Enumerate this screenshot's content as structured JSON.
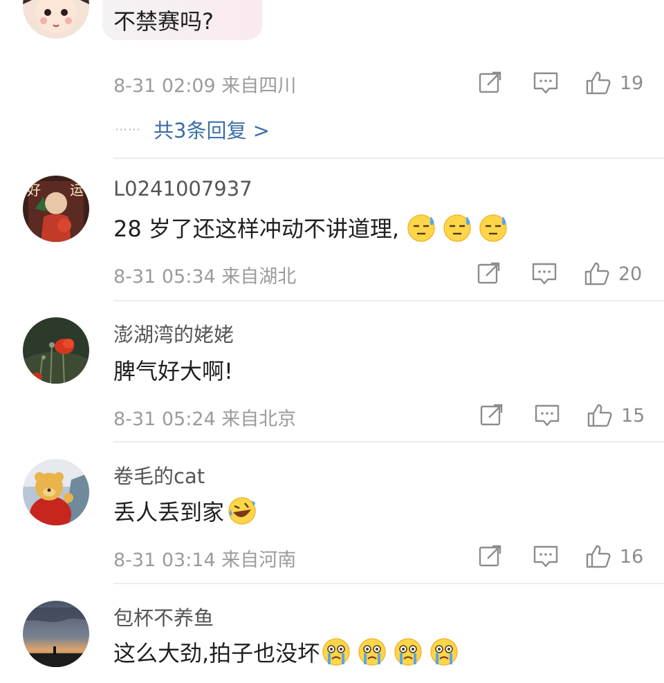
{
  "comments": [
    {
      "name": "",
      "text": "不禁赛吗?",
      "date": "8-31 02:09",
      "location": "来自四川",
      "likes": "19",
      "replies": "共3条回复 >"
    },
    {
      "name": "L0241007937",
      "text": "28 岁了还这样冲动不讲道理,",
      "emojis": [
        "sweat-emoji",
        "sweat-emoji",
        "sweat-emoji"
      ],
      "date": "8-31 05:34",
      "location": "来自湖北",
      "likes": "20"
    },
    {
      "name": "澎湖湾的姥姥",
      "text": "脾气好大啊!",
      "date": "8-31 05:24",
      "location": "来自北京",
      "likes": "15"
    },
    {
      "name": "卷毛的cat",
      "text": "丢人丢到家",
      "emojis": [
        "laugh-cry-emoji"
      ],
      "date": "8-31 03:14",
      "location": "来自河南",
      "likes": "16"
    },
    {
      "name": "包杯不养鱼",
      "text": "这么大劲,拍子也没坏",
      "emojis": [
        "crying-emoji",
        "crying-emoji",
        "crying-emoji",
        "crying-emoji"
      ]
    }
  ],
  "replies_dots": "⋯⋯",
  "avatar_text": {
    "left": "好",
    "right": "运"
  },
  "colors": {
    "link": "#3b6ea5",
    "meta": "#9b9b9b",
    "divider": "#ececec"
  }
}
